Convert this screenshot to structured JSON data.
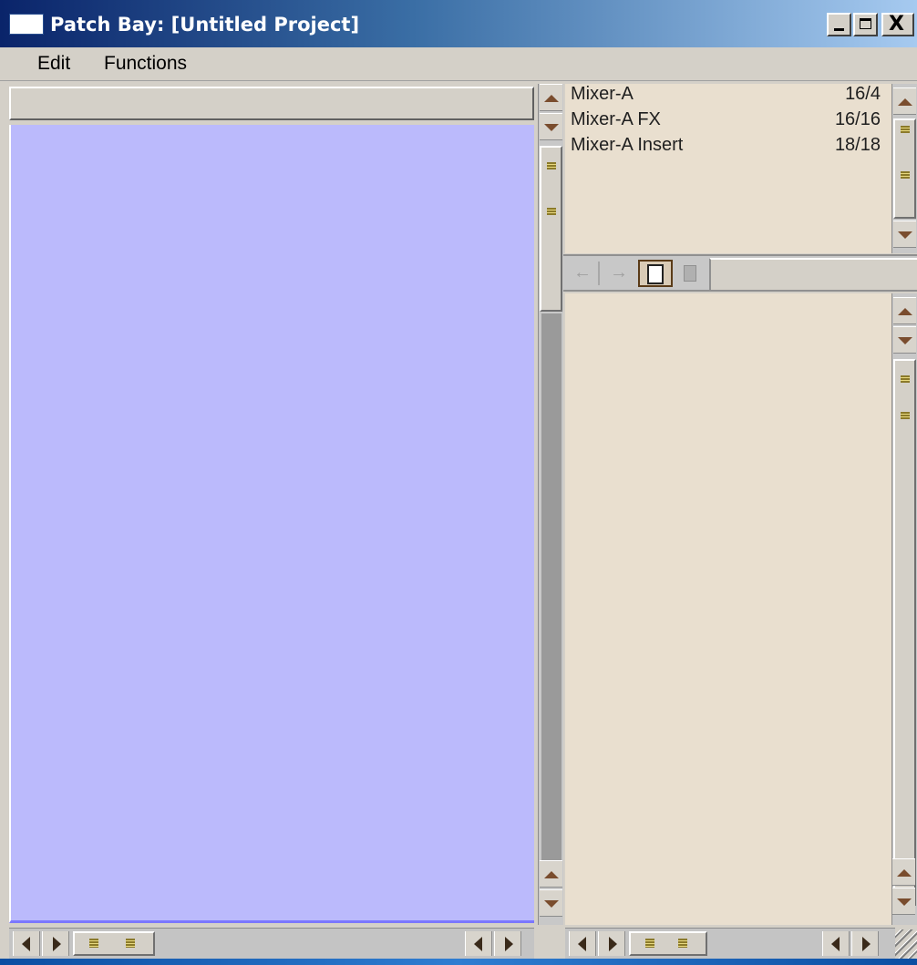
{
  "window": {
    "title": "Patch Bay: [Untitled Project]",
    "controls": {
      "minimize": "_",
      "maximize": "□",
      "close": "X"
    }
  },
  "menu": {
    "items": [
      {
        "label": "Edit"
      },
      {
        "label": "Functions"
      }
    ]
  },
  "devices": [
    {
      "name": "Mixer-A",
      "ports": "16/4"
    },
    {
      "name": "Mixer-A FX",
      "ports": "16/16"
    },
    {
      "name": "Mixer-A Insert",
      "ports": "18/18"
    }
  ],
  "toolbar": {
    "icons": [
      "back-arrow-icon",
      "forward-arrow-icon",
      "new-document-icon",
      "trash-icon"
    ],
    "back_glyph": "←",
    "forward_glyph": "→"
  },
  "colors": {
    "left_canvas": "#bbbafc",
    "right_panel": "#e9dfcf",
    "scroll_arrow": "#7a4d2e"
  }
}
